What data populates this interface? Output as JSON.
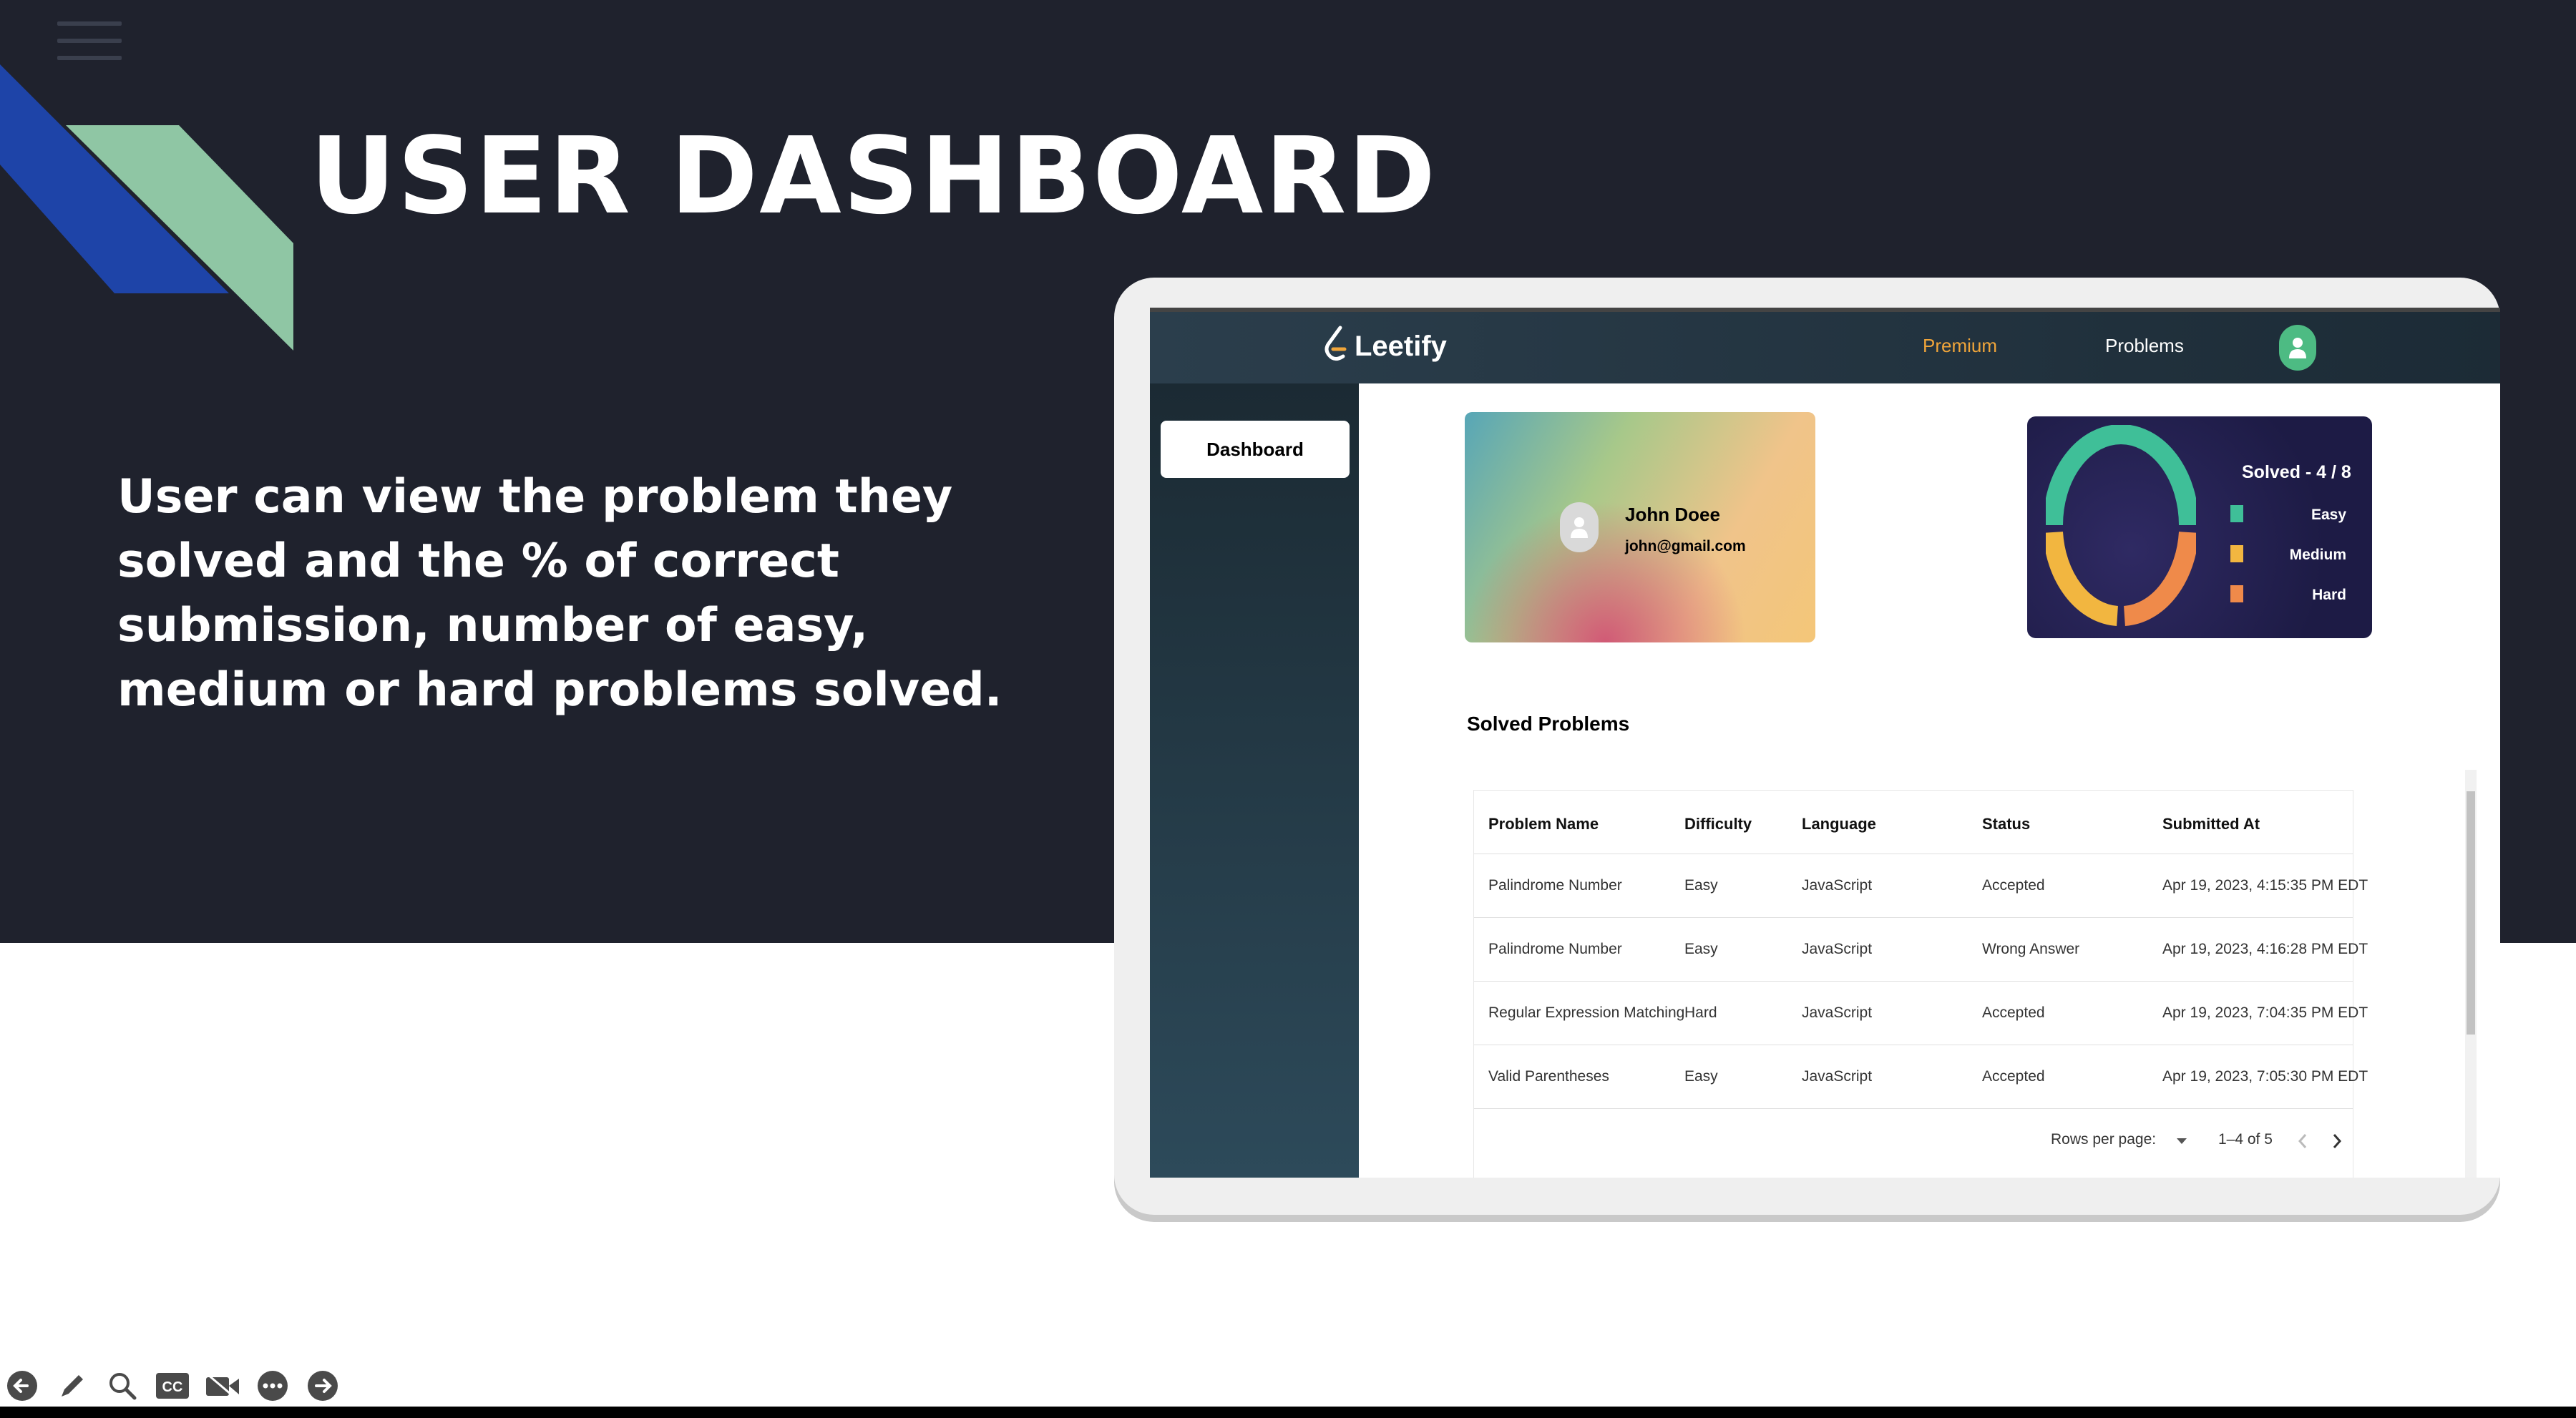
{
  "slide": {
    "title": "USER DASHBOARD",
    "description": "User can view the problem they solved and the % of correct submission, number of easy, medium or hard problems solved.",
    "accent_colors": {
      "background": "#1f222d",
      "blue": "#1e44a8",
      "green": "#8fc6a4"
    }
  },
  "app": {
    "brand": "Leetify",
    "nav": {
      "premium": "Premium",
      "problems": "Problems"
    },
    "sidebar": {
      "dashboard_label": "Dashboard"
    },
    "profile": {
      "name": "John Doee",
      "email": "john@gmail.com"
    },
    "stats": {
      "solved_label": "Solved - 4 / 8",
      "legend": [
        {
          "label": "Easy",
          "color": "#3fbf98"
        },
        {
          "label": "Medium",
          "color": "#f2b640"
        },
        {
          "label": "Hard",
          "color": "#ef8a4a"
        }
      ]
    },
    "solved_section_title": "Solved Problems",
    "table": {
      "headers": [
        "Problem Name",
        "Difficulty",
        "Language",
        "Status",
        "Submitted At"
      ],
      "rows": [
        [
          "Palindrome Number",
          "Easy",
          "JavaScript",
          "Accepted",
          "Apr 19, 2023, 4:15:35 PM EDT"
        ],
        [
          "Palindrome Number",
          "Easy",
          "JavaScript",
          "Wrong Answer",
          "Apr 19, 2023, 4:16:28 PM EDT"
        ],
        [
          "Regular Expression Matching",
          "Hard",
          "JavaScript",
          "Accepted",
          "Apr 19, 2023, 7:04:35 PM EDT"
        ],
        [
          "Valid Parentheses",
          "Easy",
          "JavaScript",
          "Accepted",
          "Apr 19, 2023, 7:05:30 PM EDT"
        ]
      ],
      "rows_per_page_label": "Rows per page:",
      "page_range": "1–4 of 5"
    }
  },
  "toolbar_icons": [
    "back-arrow-icon",
    "pen-icon",
    "zoom-icon",
    "closed-captions-icon",
    "video-off-icon",
    "more-options-icon",
    "forward-arrow-icon"
  ]
}
